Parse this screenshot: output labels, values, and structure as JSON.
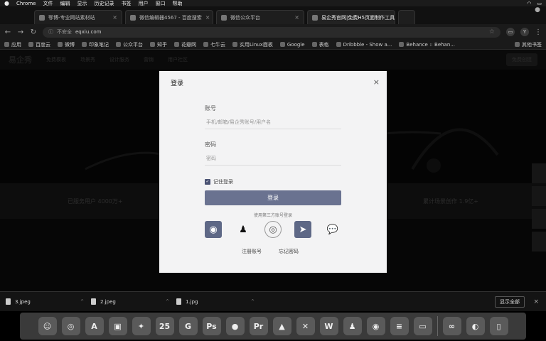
{
  "menubar": {
    "apple": "",
    "items": [
      "Chrome",
      "文件",
      "编辑",
      "显示",
      "历史记录",
      "书签",
      "用户",
      "窗口",
      "帮助"
    ]
  },
  "tabs": [
    {
      "title": "鄂博-专业网站素材站"
    },
    {
      "title": "微信编辑器4567 - 百度搜索"
    },
    {
      "title": "微信公众平台"
    },
    {
      "title": "易企秀官网|免费H5页面制作工具"
    }
  ],
  "address": {
    "security": "不安全",
    "url": "eqxiu.com"
  },
  "bookmarks": {
    "items": [
      "应用",
      "百度云",
      "微博",
      "印象笔记",
      "公众平台",
      "知乎",
      "花瓣网",
      "七牛云",
      "实用Linux面板",
      "Google",
      "表格",
      "Dribbble - Show a...",
      "Behance :: Behan..."
    ],
    "other": "其他书签"
  },
  "site": {
    "logo": "易企秀",
    "nav": [
      "免费模板",
      "场景秀",
      "设计服务",
      "营销",
      "用户社区"
    ],
    "button": "免费创建",
    "stats_left": "已服务用户 4000万+",
    "stats_right": "累计场景创作 1.9亿+"
  },
  "modal": {
    "title": "登录",
    "account_label": "账号",
    "account_placeholder": "手机/邮箱/易企秀账号/用户名",
    "password_label": "密码",
    "password_placeholder": "密码",
    "remember": "记住登录",
    "login_button": "登录",
    "alt_login": "使用第三方账号登录",
    "register": "注册账号",
    "forgot": "忘记密码"
  },
  "downloads": {
    "files": [
      "3.jpeg",
      "2.jpeg",
      "1.jpg"
    ],
    "show_all": "显示全部"
  },
  "dock": {
    "apps": [
      "finder",
      "safari",
      "app-store",
      "preview",
      "compass",
      "calendar",
      "git",
      "photoshop",
      "ball",
      "premiere",
      "keynote",
      "xmind",
      "wps",
      "qq",
      "wechat",
      "notes",
      "monitor",
      "baidu-cloud",
      "teamviewer",
      "trash"
    ],
    "calendar_day": "25",
    "wps_label": "W"
  }
}
